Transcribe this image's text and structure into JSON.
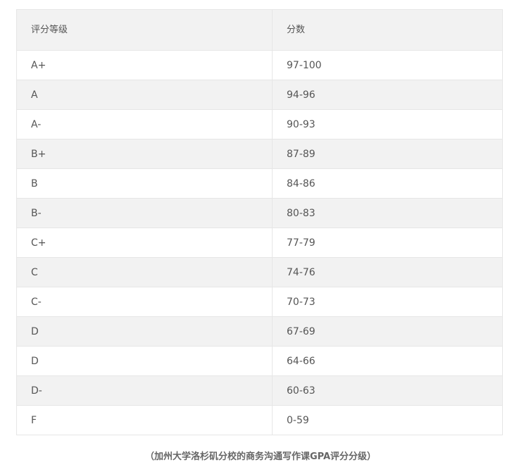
{
  "table": {
    "headers": [
      "评分等级",
      "分数"
    ],
    "rows": [
      [
        "A+",
        "97-100"
      ],
      [
        "A",
        "94-96"
      ],
      [
        "A-",
        "90-93"
      ],
      [
        "B+",
        "87-89"
      ],
      [
        "B",
        "84-86"
      ],
      [
        "B-",
        "80-83"
      ],
      [
        "C+",
        "77-79"
      ],
      [
        "C",
        "74-76"
      ],
      [
        "C-",
        "70-73"
      ],
      [
        "D",
        "67-69"
      ],
      [
        "D",
        "64-66"
      ],
      [
        "D-",
        "60-63"
      ],
      [
        "F",
        "0-59"
      ]
    ]
  },
  "caption": "（加州大学洛杉矶分校的商务沟通写作课GPA评分分级）"
}
